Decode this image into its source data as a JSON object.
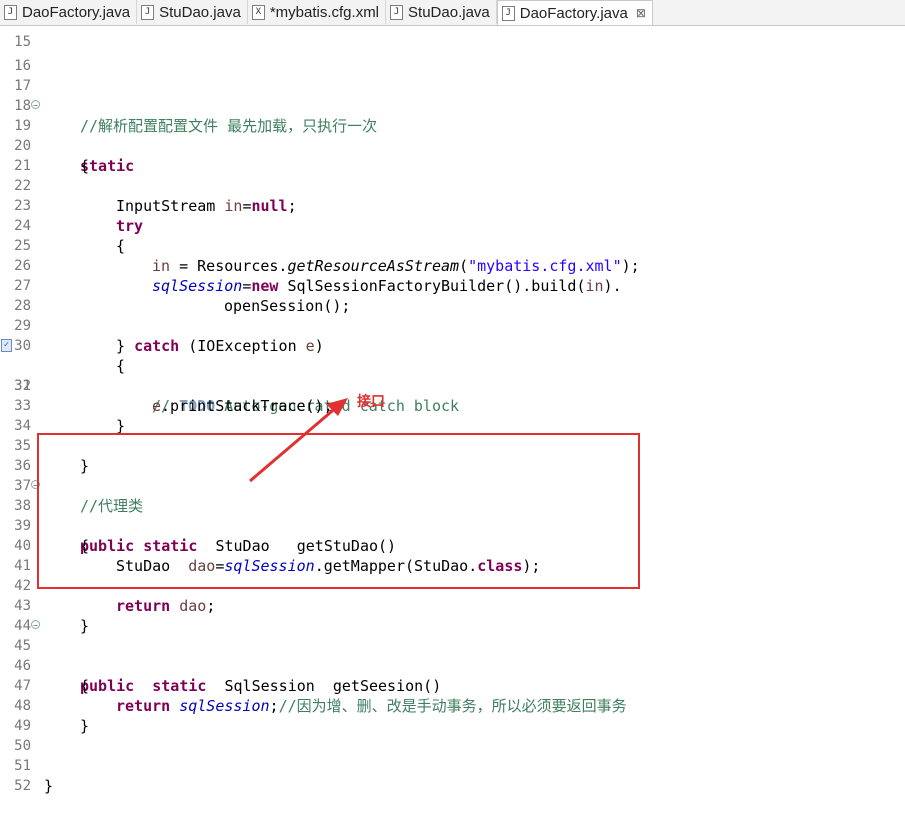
{
  "tabs": [
    {
      "label": "DaoFactory.java",
      "icon": "java-file-icon",
      "active": false
    },
    {
      "label": "StuDao.java",
      "icon": "java-file-icon",
      "active": false
    },
    {
      "label": "*mybatis.cfg.xml",
      "icon": "xml-file-icon",
      "active": false
    },
    {
      "label": "StuDao.java",
      "icon": "java-file-icon",
      "active": false
    },
    {
      "label": "DaoFactory.java",
      "icon": "java-file-icon",
      "active": true
    }
  ],
  "tab_close_glyph": "⊠",
  "code": {
    "ln15": "15",
    "ln16": "16",
    "ln17": "17",
    "ln18": "18",
    "c18": "//解析配置配置文件 最先加载，只执行一次",
    "ln19": "19",
    "c19_kw": "static",
    "ln20": "20",
    "c20": "{",
    "ln21": "21",
    "ln22": "22",
    "c22_a": "InputStream ",
    "c22_b": "in",
    "c22_c": "=",
    "c22_d": "null",
    "c22_e": ";",
    "ln23": "23",
    "c23_kw": "try",
    "ln24": "24",
    "c24": "{",
    "ln25": "25",
    "c25_a": "in",
    "c25_b": " = Resources.",
    "c25_c": "getResourceAsStream",
    "c25_d": "(",
    "c25_e": "\"mybatis.cfg.xml\"",
    "c25_f": ");",
    "ln26": "26",
    "c26_a": "sqlSession",
    "c26_b": "=",
    "c26_c": "new",
    "c26_d": " SqlSessionFactoryBuilder().build(",
    "c26_e": "in",
    "c26_f": ").",
    "ln27": "27",
    "c27": "openSession();",
    "ln28": "28",
    "ln29": "29",
    "c29_a": "} ",
    "c29_b": "catch",
    "c29_c": " (IOException ",
    "c29_d": "e",
    "c29_e": ")",
    "ln30": "30",
    "c30": "{",
    "ln31": "31",
    "c31_a": "// ",
    "c31_b": "TODO",
    "c31_c": " Auto-generated catch block",
    "ln32": "32",
    "c32_a": "e",
    "c32_b": ".printStackTrace();",
    "ln33": "33",
    "c33": "}",
    "ln34": "34",
    "ln35": "35",
    "c35": "}",
    "ln36": "36",
    "ln37": "37",
    "c37": "//代理类",
    "ln38": "38",
    "c38_a": "public",
    "c38_b": " ",
    "c38_c": "static",
    "c38_d": "  StuDao   getStuDao()",
    "ln39": "39",
    "c39": "{",
    "ln40": "40",
    "c40_a": "StuDao  ",
    "c40_b": "dao",
    "c40_c": "=",
    "c40_d": "sqlSession",
    "c40_e": ".getMapper(StuDao.",
    "c40_f": "class",
    "c40_g": ");",
    "ln41": "41",
    "ln42": "42",
    "c42_a": "return",
    "c42_b": " ",
    "c42_c": "dao",
    "c42_d": ";",
    "ln43": "43",
    "c43": "}",
    "ln44": "44",
    "ln45": "45",
    "c45_a": "public",
    "c45_b": "  ",
    "c45_c": "static",
    "c45_d": "  SqlSession  getSeesion()",
    "ln46": "46",
    "c46": "{",
    "ln47": "47",
    "c47_a": "return",
    "c47_b": " ",
    "c47_c": "sqlSession",
    "c47_d": ";",
    "c47_e": "//因为增、删、改是手动事务，所以必须要返回事务",
    "ln48": "48",
    "c48": "}",
    "ln49": "49",
    "ln50": "50",
    "ln51": "51",
    "c51": "}",
    "ln52": "52"
  },
  "annotation": {
    "label": "接口",
    "color": "#e03030"
  },
  "colors": {
    "keyword": "#7f0055",
    "comment": "#3f7f5f",
    "string": "#2a00ff",
    "field": "#0000c0",
    "local_var": "#6a3e3e",
    "line_number": "#787878"
  }
}
